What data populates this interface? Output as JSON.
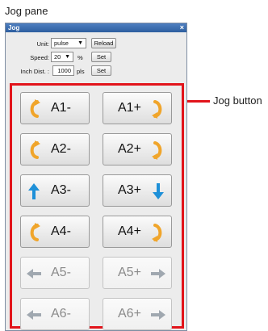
{
  "captions": {
    "pane": "Jog pane",
    "button": "Jog button"
  },
  "window": {
    "title": "Jog",
    "close": "×"
  },
  "settings": {
    "unit_label": "Unit:",
    "unit_value": "pulse",
    "reload": "Reload",
    "speed_label": "Speed:",
    "speed_value": "20",
    "speed_unit": "%",
    "set": "Set",
    "inch_label": "Inch Dist. :",
    "inch_value": "1000",
    "inch_unit": "pls"
  },
  "jog_buttons": [
    {
      "minus": "A1-",
      "plus": "A1+",
      "icon_minus": "rotate-ccw-icon",
      "icon_plus": "rotate-cw-icon",
      "enabled": true
    },
    {
      "minus": "A2-",
      "plus": "A2+",
      "icon_minus": "rotate-ccw-icon",
      "icon_plus": "rotate-cw-icon",
      "enabled": true
    },
    {
      "minus": "A3-",
      "plus": "A3+",
      "icon_minus": "arrow-up-icon",
      "icon_plus": "arrow-down-icon",
      "enabled": true
    },
    {
      "minus": "A4-",
      "plus": "A4+",
      "icon_minus": "rotate-ccw-icon",
      "icon_plus": "rotate-cw-icon",
      "enabled": true
    },
    {
      "minus": "A5-",
      "plus": "A5+",
      "icon_minus": "arrow-left-icon",
      "icon_plus": "arrow-right-icon",
      "enabled": false
    },
    {
      "minus": "A6-",
      "plus": "A6+",
      "icon_minus": "arrow-left-icon",
      "icon_plus": "arrow-right-icon",
      "enabled": false
    }
  ],
  "colors": {
    "rotate": "#f0a52b",
    "axis": "#1e90d8",
    "disabled_arrow": "#a0a8b0",
    "highlight": "#e2141b"
  }
}
